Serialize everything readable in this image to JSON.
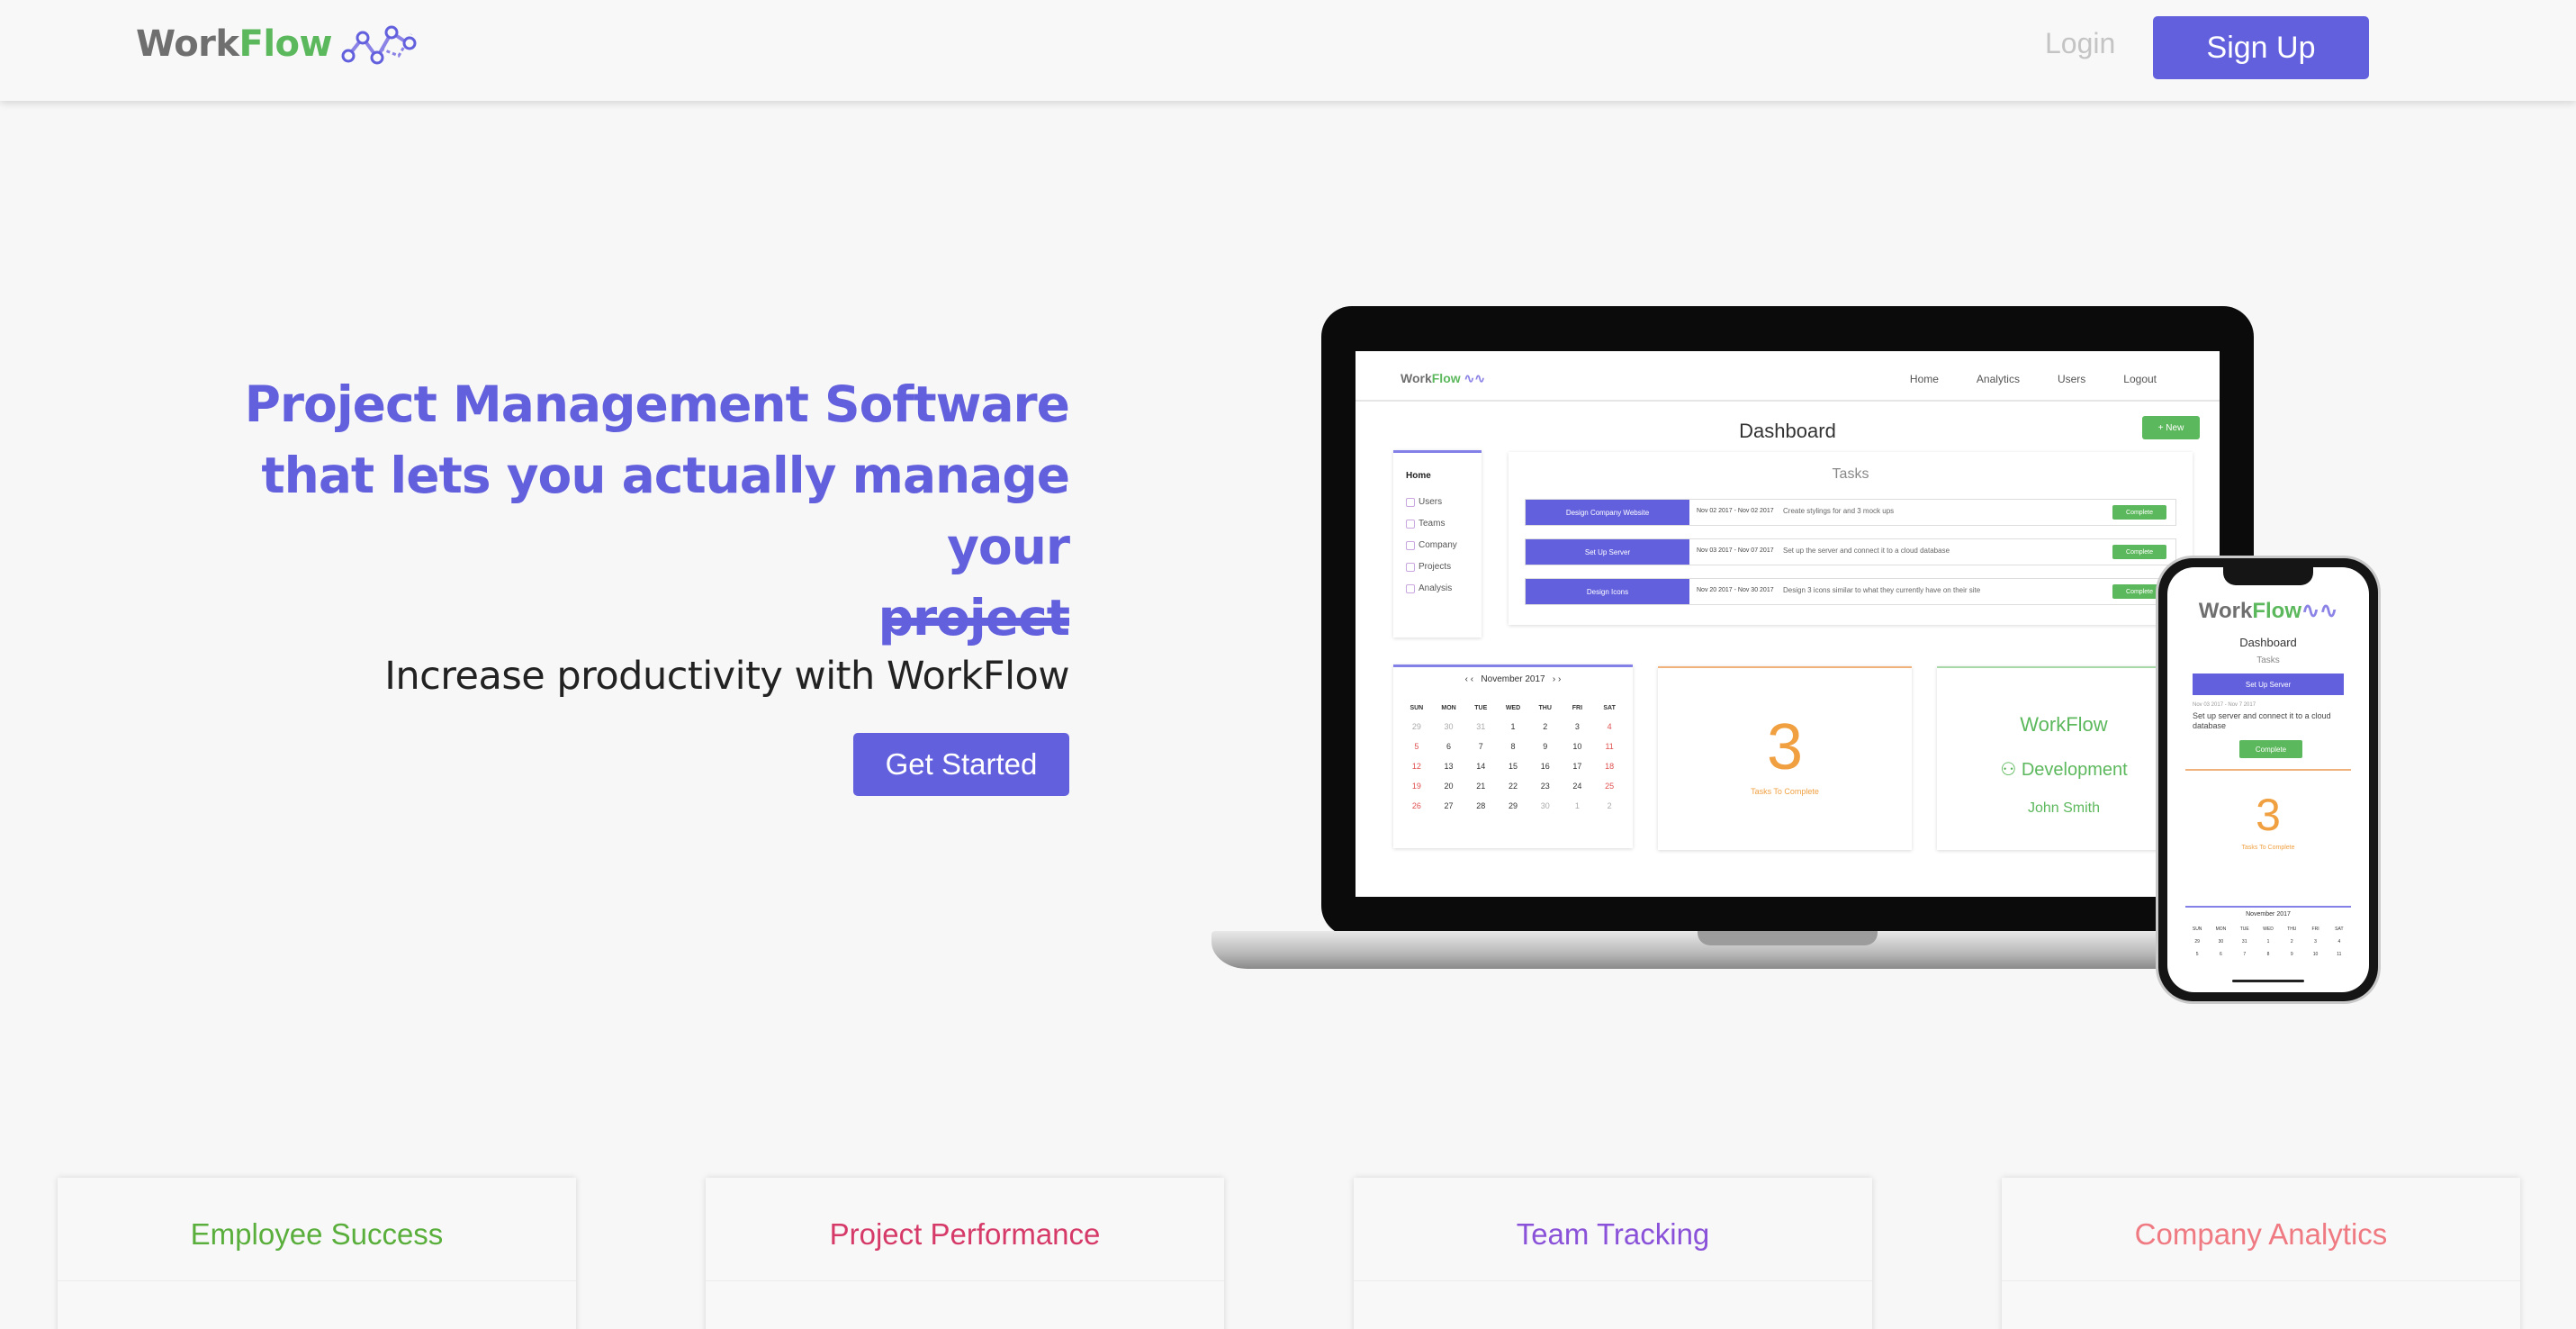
{
  "brand": {
    "work": "Work",
    "flow": "Flow"
  },
  "nav": {
    "login": "Login",
    "signup": "Sign Up"
  },
  "hero": {
    "title_lines": [
      "Project Management Software",
      "that lets you actually manage your",
      "project"
    ],
    "subtitle": "Increase productivity with WorkFlow",
    "cta": "Get Started"
  },
  "colors": {
    "primary": "#6360de",
    "green": "#5cb85c",
    "orange": "#f0a040"
  },
  "laptop_screen": {
    "nav_links": [
      "Home",
      "Analytics",
      "Users",
      "Logout"
    ],
    "title": "Dashboard",
    "new_button": "+ New",
    "sidebar": {
      "home": "Home",
      "items": [
        "Users",
        "Teams",
        "Company",
        "Projects",
        "Analysis"
      ]
    },
    "tasks_heading": "Tasks",
    "tasks": [
      {
        "name": "Design Company Website",
        "dates": "Nov 02 2017 - Nov 02 2017",
        "desc": "Create stylings for and 3 mock ups",
        "action": "Complete"
      },
      {
        "name": "Set Up Server",
        "dates": "Nov 03 2017 - Nov 07 2017",
        "desc": "Set up the server and connect it to a cloud database",
        "action": "Complete"
      },
      {
        "name": "Design Icons",
        "dates": "Nov 20 2017 - Nov 30 2017",
        "desc": "Design 3 icons similar to what they currently have on their site",
        "action": "Complete"
      }
    ],
    "calendar": {
      "month": "November 2017",
      "day_headers": [
        "SUN",
        "MON",
        "TUE",
        "WED",
        "THU",
        "FRI",
        "SAT"
      ],
      "days": [
        "29",
        "30",
        "31",
        "1",
        "2",
        "3",
        "4",
        "5",
        "6",
        "7",
        "8",
        "9",
        "10",
        "11",
        "12",
        "13",
        "14",
        "15",
        "16",
        "17",
        "18",
        "19",
        "20",
        "21",
        "22",
        "23",
        "24",
        "25",
        "26",
        "27",
        "28",
        "29",
        "30",
        "1",
        "2"
      ]
    },
    "tasks_count": {
      "value": "3",
      "label": "Tasks To Complete"
    },
    "team_card": {
      "company": "WorkFlow",
      "team": "Development",
      "user": "John Smith"
    }
  },
  "phone_screen": {
    "title": "Dashboard",
    "tasks_heading": "Tasks",
    "task_button": "Set Up Server",
    "task_dates": "Nov 03 2017 - Nov 7 2017",
    "task_desc": "Set up server and connect it to a cloud database",
    "complete": "Complete",
    "count": "3",
    "count_label": "Tasks To Complete",
    "calendar_month": "November 2017"
  },
  "features": [
    {
      "title": "Employee Success",
      "color": "#5aaf3c"
    },
    {
      "title": "Project Performance",
      "color": "#d63a68"
    },
    {
      "title": "Team Tracking",
      "color": "#8a52d8"
    },
    {
      "title": "Company Analytics",
      "color": "#ef7a82"
    }
  ]
}
